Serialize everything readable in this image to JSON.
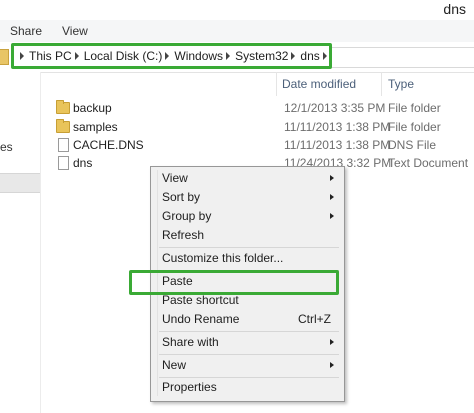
{
  "window": {
    "title": "dns"
  },
  "ribbon": {
    "tabs": [
      "Share",
      "View"
    ]
  },
  "address": {
    "crumbs": [
      "This PC",
      "Local Disk (C:)",
      "Windows",
      "System32",
      "dns"
    ],
    "highlight_color": "#3aaa35"
  },
  "nav": {
    "partial_text": "es"
  },
  "columns": {
    "date": "Date modified",
    "type": "Type"
  },
  "files": [
    {
      "name": "backup",
      "date": "12/1/2013 3:35 PM",
      "type": "File folder",
      "icon": "folder-icon"
    },
    {
      "name": "samples",
      "date": "11/11/2013 1:38 PM",
      "type": "File folder",
      "icon": "folder-icon"
    },
    {
      "name": "CACHE.DNS",
      "date": "11/11/2013 1:38 PM",
      "type": "DNS File",
      "icon": "document-icon"
    },
    {
      "name": "dns",
      "date": "11/24/2013 3:32 PM",
      "type": "Text Document",
      "icon": "document-icon"
    }
  ],
  "context_menu": {
    "items": [
      {
        "label": "View",
        "submenu": true
      },
      {
        "label": "Sort by",
        "submenu": true
      },
      {
        "label": "Group by",
        "submenu": true
      },
      {
        "label": "Refresh"
      },
      {
        "label": "Customize this folder..."
      },
      {
        "label": "Paste",
        "highlighted": true
      },
      {
        "label": "Paste shortcut"
      },
      {
        "label": "Undo Rename",
        "shortcut": "Ctrl+Z"
      },
      {
        "label": "Share with",
        "submenu": true
      },
      {
        "label": "New",
        "submenu": true
      },
      {
        "label": "Properties"
      }
    ]
  }
}
